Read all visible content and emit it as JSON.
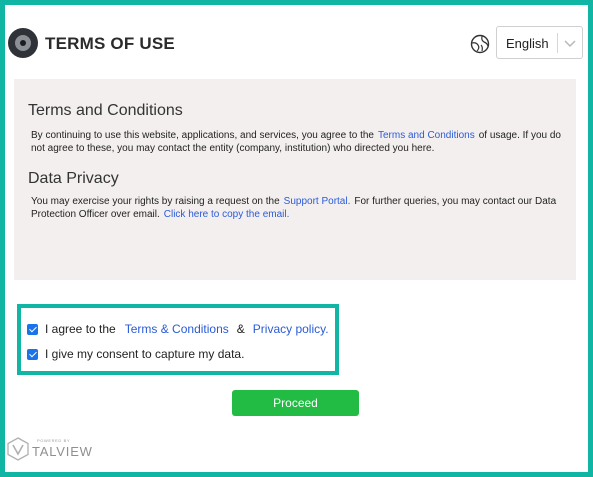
{
  "header": {
    "title": "TERMS OF USE",
    "language": "English"
  },
  "terms": {
    "heading": "Terms and Conditions",
    "text_before": "By continuing to use this website, applications, and services, you agree to the",
    "link": "Terms and Conditions",
    "text_after": "of usage. If you do not agree to these, you may contact the entity (company, institution) who directed you here."
  },
  "privacy": {
    "heading": "Data Privacy",
    "text_before": "You may exercise your rights by raising a request on the",
    "portal_link": "Support Portal.",
    "text_middle": "For further queries, you may contact our Data Protection Officer over email.",
    "copy_link": "Click here to copy the email."
  },
  "consent": {
    "agree_text": "I agree to the",
    "terms_link": "Terms & Conditions",
    "ampersand": "&",
    "privacy_link": "Privacy policy.",
    "data_text": "I give my consent to capture my data.",
    "agree_checked": true,
    "data_checked": true
  },
  "proceed_label": "Proceed",
  "brand": {
    "powered_by": "POWERED BY",
    "name": "TALVIEW"
  },
  "colors": {
    "accent": "#10b5a4",
    "link": "#2a5bd7",
    "proceed": "#22bb44",
    "checkbox": "#1a73e8"
  }
}
